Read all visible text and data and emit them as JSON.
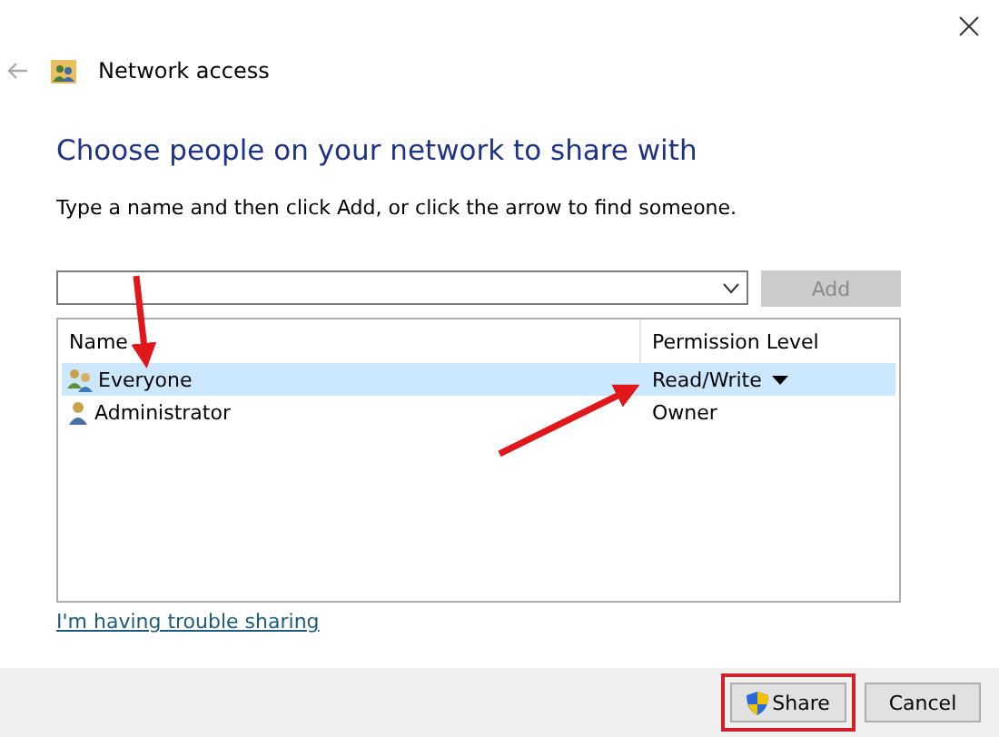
{
  "window": {
    "title": "Network access"
  },
  "heading": "Choose people on your network to share with",
  "instruction": "Type a name and then click Add, or click the arrow to find someone.",
  "add_button": {
    "label": "Add",
    "disabled": true
  },
  "table": {
    "columns": [
      "Name",
      "Permission Level"
    ],
    "rows": [
      {
        "name": "Everyone",
        "kind": "group",
        "permission": "Read/Write",
        "selected": true
      },
      {
        "name": "Administrator",
        "kind": "user",
        "permission": "Owner",
        "selected": false
      }
    ]
  },
  "help_link": "I'm having trouble sharing",
  "annotations": [
    {
      "kind": "arrow"
    },
    {
      "kind": "arrow"
    }
  ],
  "buttons": [
    {
      "label": "Share",
      "kind": "shield",
      "highlighted": true
    },
    {
      "label": "Cancel",
      "kind": "plain",
      "highlighted": false
    }
  ]
}
